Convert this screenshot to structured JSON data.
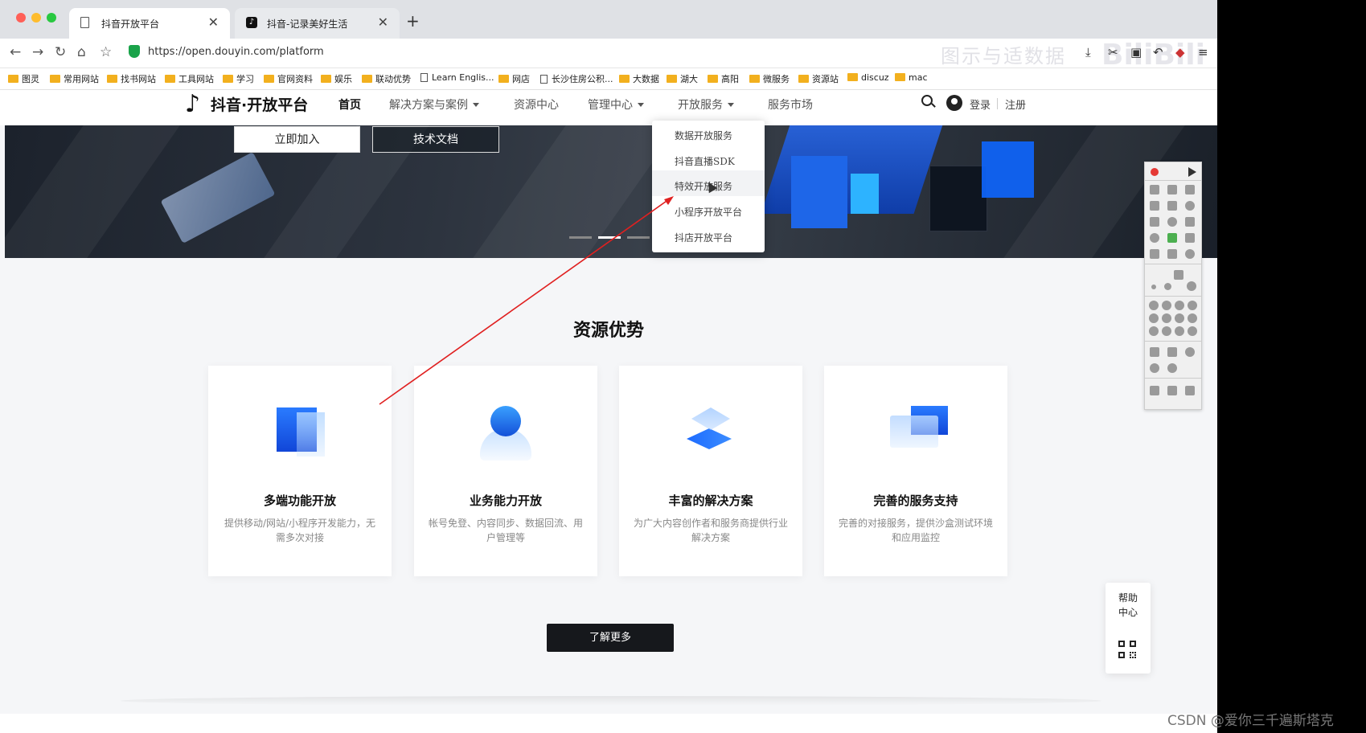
{
  "browser": {
    "tabs": [
      {
        "label": "抖音开放平台",
        "icon": "document-icon"
      },
      {
        "label": "抖音-记录美好生活",
        "icon": "tiktok-icon"
      }
    ],
    "close_glyph": "✕",
    "new_tab_glyph": "+",
    "url": "https://open.douyin.com/platform",
    "bookmarks": [
      {
        "label": "图灵",
        "type": "folder"
      },
      {
        "label": "常用网站",
        "type": "folder"
      },
      {
        "label": "找书网站",
        "type": "folder"
      },
      {
        "label": "工具网站",
        "type": "folder"
      },
      {
        "label": "学习",
        "type": "folder"
      },
      {
        "label": "官网资料",
        "type": "folder"
      },
      {
        "label": "娱乐",
        "type": "folder"
      },
      {
        "label": "联动优势",
        "type": "folder"
      },
      {
        "label": "Learn Englis...",
        "type": "page"
      },
      {
        "label": "网店",
        "type": "folder"
      },
      {
        "label": "长沙住房公积...",
        "type": "page"
      },
      {
        "label": "大数据",
        "type": "folder"
      },
      {
        "label": "湖大",
        "type": "folder"
      },
      {
        "label": "高阳",
        "type": "folder"
      },
      {
        "label": "微服务",
        "type": "folder"
      },
      {
        "label": "资源站",
        "type": "folder"
      },
      {
        "label": "discuz",
        "type": "folder"
      },
      {
        "label": "mac",
        "type": "folder"
      }
    ],
    "watermark": "图示与适数据",
    "watermark_logo": "BiliBili"
  },
  "site": {
    "logo": "抖音·开放平台",
    "nav": [
      {
        "label": "首页",
        "active": true,
        "dropdown": false
      },
      {
        "label": "解决方案与案例",
        "active": false,
        "dropdown": true
      },
      {
        "label": "资源中心",
        "active": false,
        "dropdown": false
      },
      {
        "label": "管理中心",
        "active": false,
        "dropdown": true
      },
      {
        "label": "开放服务",
        "active": false,
        "dropdown": true
      },
      {
        "label": "服务市场",
        "active": false,
        "dropdown": false
      }
    ],
    "login": "登录",
    "register": "注册",
    "banner": {
      "join_button": "立即加入",
      "docs_button": "技术文档"
    },
    "open_service_menu": [
      "数据开放服务",
      "抖音直播SDK",
      "特效开放服务",
      "小程序开放平台",
      "抖店开放平台"
    ],
    "section_title": "资源优势",
    "cards": [
      {
        "title": "多端功能开放",
        "desc": "提供移动/网站/小程序开发能力，无需多次对接"
      },
      {
        "title": "业务能力开放",
        "desc": "帐号免登、内容同步、数据回流、用户管理等"
      },
      {
        "title": "丰富的解决方案",
        "desc": "为广大内容创作者和服务商提供行业解决方案"
      },
      {
        "title": "完善的服务支持",
        "desc": "完善的对接服务，提供沙盒测试环境和应用监控"
      }
    ],
    "more_button": "了解更多",
    "help": "帮助中心"
  },
  "colors": {
    "brand_dark": "#16181c",
    "accent_blue": "#1e66ff",
    "annotation_arrow": "#e02020"
  },
  "footer_watermark": "CSDN @爱你三千遍斯塔克"
}
